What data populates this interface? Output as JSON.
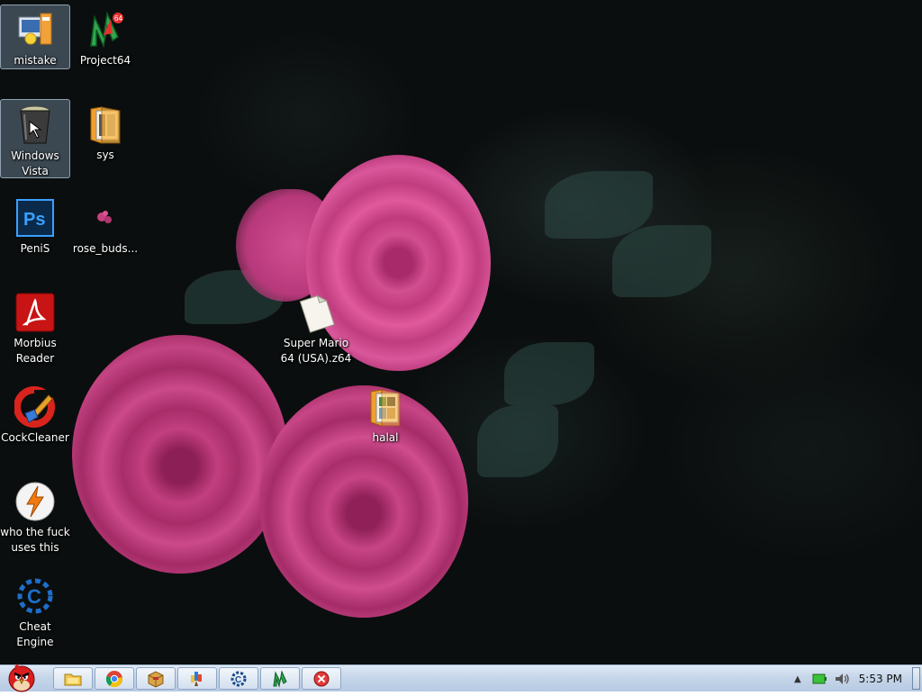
{
  "desktop_icons": [
    {
      "label": "mistake",
      "icon": "monitor-folder-icon"
    },
    {
      "label": "Project64",
      "icon": "project64-icon"
    },
    {
      "label": "Windows Vista",
      "icon": "recycle-bin-icon"
    },
    {
      "label": "sys",
      "icon": "folder-icon"
    },
    {
      "label": "PeniS",
      "icon": "photoshop-icon"
    },
    {
      "label": "rose_buds...",
      "icon": "image-thumbnail-icon"
    },
    {
      "label": "Morbius Reader",
      "icon": "adobe-reader-icon"
    },
    {
      "label": "CockCleaner",
      "icon": "ccleaner-icon"
    },
    {
      "label": "who the fuck uses this",
      "icon": "winamp-icon"
    },
    {
      "label": "Cheat Engine",
      "icon": "cheat-engine-icon"
    },
    {
      "label": "Super Mario 64 (USA).z64",
      "icon": "file-icon"
    },
    {
      "label": "halal",
      "icon": "folder-icon"
    }
  ],
  "taskbar": {
    "start_icon": "angry-bird-icon",
    "pinned": [
      {
        "icon": "explorer-icon"
      },
      {
        "icon": "chrome-icon"
      },
      {
        "icon": "package-icon"
      },
      {
        "icon": "paint-icon"
      },
      {
        "icon": "cheat-engine-icon"
      },
      {
        "icon": "project64-icon"
      },
      {
        "icon": "close-app-icon"
      }
    ],
    "clock": "5:53 PM"
  },
  "colors": {
    "taskbar": "#c6d6ea",
    "desktop": "#0b0e0e",
    "rose": "#d24f90"
  }
}
